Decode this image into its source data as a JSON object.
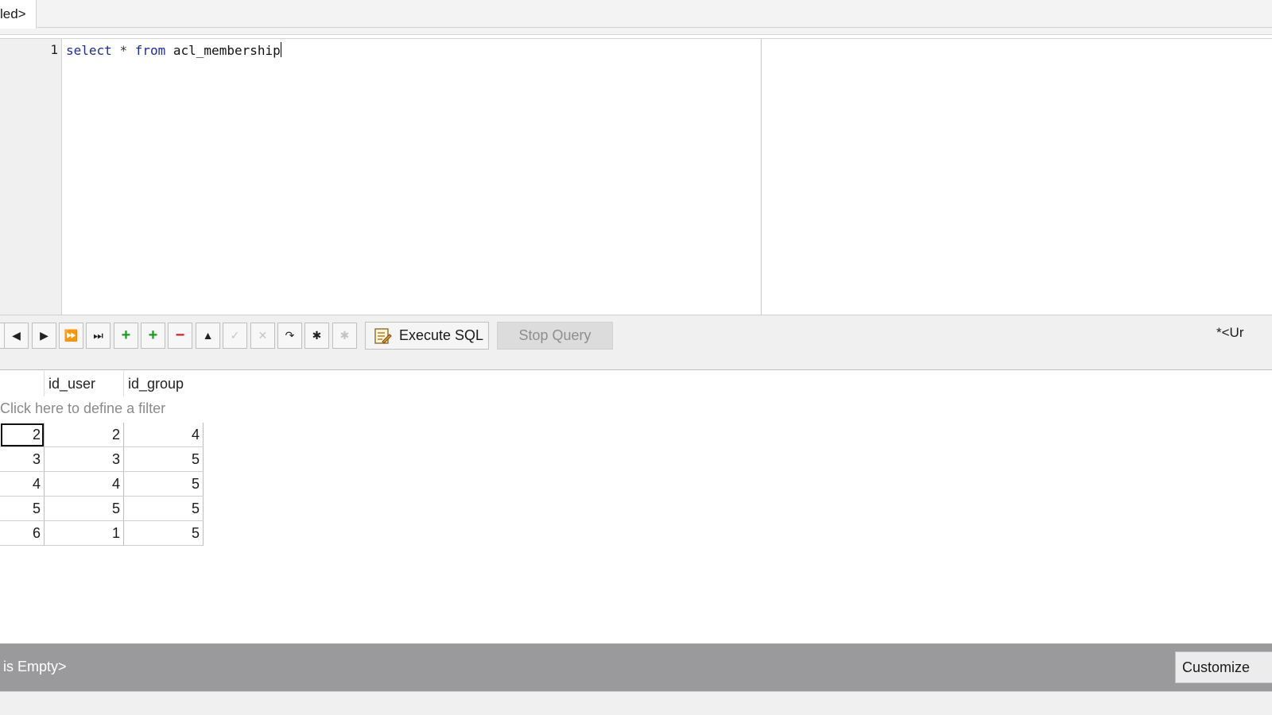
{
  "tab": {
    "label": "led>"
  },
  "editor": {
    "line_number": "1",
    "keyword_select": "select",
    "star": "*",
    "keyword_from": "from",
    "table_name": "acl_membership"
  },
  "toolbar": {
    "nav_buttons": [
      "prev-icon",
      "next-icon",
      "fast-forward-icon",
      "last-icon"
    ],
    "execute_label": "Execute SQL",
    "stop_label": "Stop Query",
    "right_tab_label": "*<Ur"
  },
  "results": {
    "columns": [
      "id_user",
      "id_group"
    ],
    "filter_text": "Click here to define a filter",
    "rows": [
      {
        "id": "2",
        "id_user": "2",
        "id_group": "4"
      },
      {
        "id": "3",
        "id_user": "3",
        "id_group": "5"
      },
      {
        "id": "4",
        "id_user": "4",
        "id_group": "5"
      },
      {
        "id": "5",
        "id_user": "5",
        "id_group": "5"
      },
      {
        "id": "6",
        "id_user": "1",
        "id_group": "5"
      }
    ]
  },
  "status": {
    "text": "is Empty>",
    "customize_label": "Customize"
  }
}
